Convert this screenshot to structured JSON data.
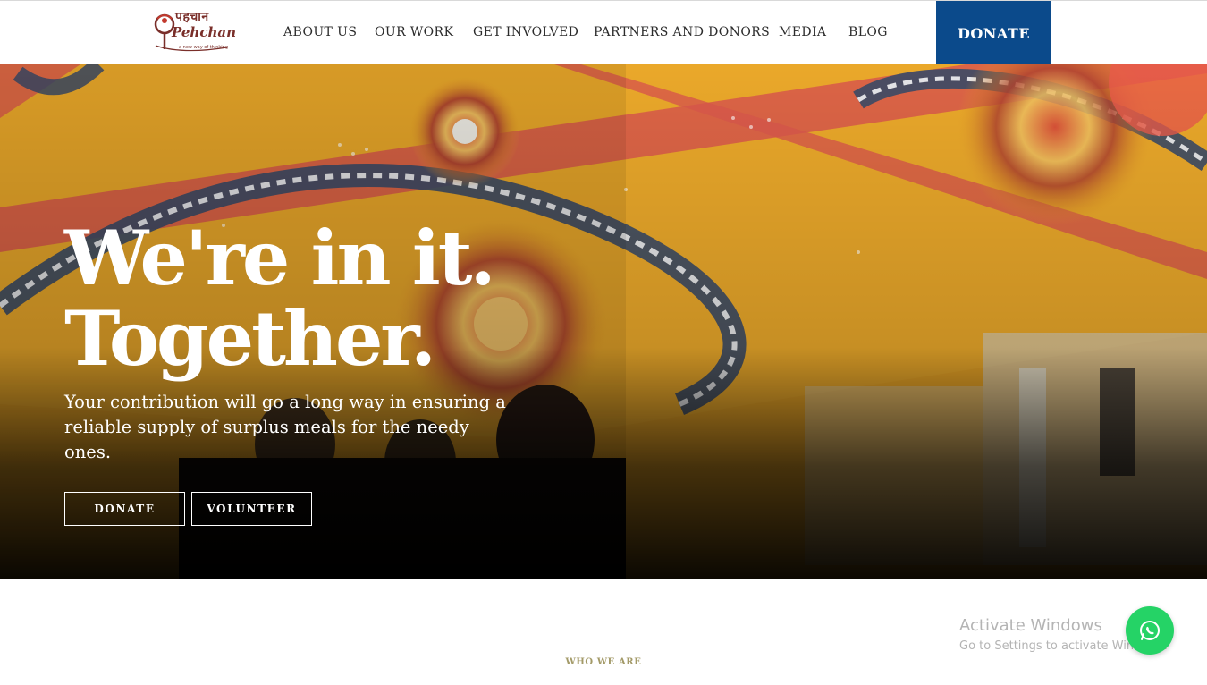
{
  "header": {
    "logo": {
      "devanagari": "पहचान",
      "latin": "Pehchan",
      "tagline": "a new way of thinking"
    },
    "nav": [
      {
        "label": "ABOUT US"
      },
      {
        "label": "OUR WORK"
      },
      {
        "label": "GET INVOLVED"
      },
      {
        "label": "PARTNERS AND DONORS"
      },
      {
        "label": "MEDIA"
      },
      {
        "label": "BLOG"
      }
    ],
    "donate_label": "DONATE"
  },
  "hero": {
    "title_line1": "We're in it.",
    "title_line2": "Together.",
    "subtitle": "Your contribution will go a long way in ensuring a reliable supply of surplus meals for the needy ones.",
    "donate_button": "DONATE",
    "volunteer_button": "VOLUNTEER"
  },
  "section": {
    "eyebrow": "WHO WE ARE"
  },
  "os_overlay": {
    "title": "Activate Windows",
    "subtitle": "Go to Settings to activate Windows."
  },
  "widgets": {
    "whatsapp_icon": "whatsapp-icon"
  },
  "colors": {
    "accent": "#0b4a8b",
    "logo": "#7a2f2a",
    "eyebrow": "#a39a68",
    "whatsapp": "#25d366"
  }
}
